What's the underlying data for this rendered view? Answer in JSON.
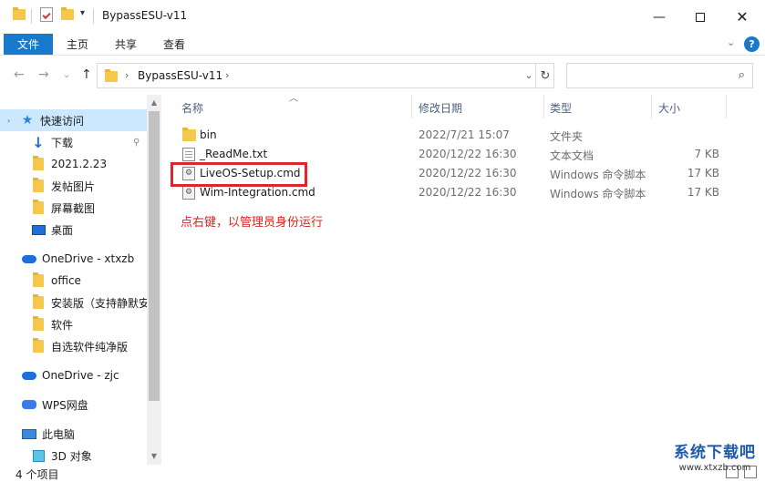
{
  "window": {
    "title": "BypassESU-v11",
    "minimize_icon": "minimize-icon",
    "maximize_icon": "maximize-icon",
    "close_icon": "close-icon"
  },
  "ribbon": {
    "tabs": [
      "文件",
      "主页",
      "共享",
      "查看"
    ],
    "accent": "#1979ca"
  },
  "address": {
    "path": "BypassESU-v11"
  },
  "search": {
    "placeholder": ""
  },
  "nav": {
    "items": [
      {
        "label": "快速访问",
        "icon": "star-icon"
      },
      {
        "label": "下载",
        "icon": "download-icon"
      },
      {
        "label": "2021.2.23",
        "icon": "folder-icon"
      },
      {
        "label": "发帖图片",
        "icon": "folder-icon"
      },
      {
        "label": "屏幕截图",
        "icon": "folder-icon"
      },
      {
        "label": "桌面",
        "icon": "desktop-icon"
      },
      {
        "label": "OneDrive - xtxzb",
        "icon": "cloud-icon"
      },
      {
        "label": "office",
        "icon": "folder-icon"
      },
      {
        "label": "安装版（支持静默安",
        "icon": "folder-icon"
      },
      {
        "label": "软件",
        "icon": "folder-icon"
      },
      {
        "label": "自选软件纯净版",
        "icon": "folder-icon"
      },
      {
        "label": "OneDrive - zjc",
        "icon": "cloud-icon"
      },
      {
        "label": "WPS网盘",
        "icon": "wps-cloud-icon"
      },
      {
        "label": "此电脑",
        "icon": "computer-icon"
      },
      {
        "label": "3D 对象",
        "icon": "3d-objects-icon"
      }
    ]
  },
  "columns": {
    "name": "名称",
    "modified": "修改日期",
    "type": "类型",
    "size": "大小"
  },
  "files": [
    {
      "name": "bin",
      "modified": "2022/7/21 15:07",
      "type": "文件夹",
      "size": "",
      "icon": "folder-icon"
    },
    {
      "name": "_ReadMe.txt",
      "modified": "2020/12/22 16:30",
      "type": "文本文档",
      "size": "7 KB",
      "icon": "text-file-icon"
    },
    {
      "name": "LiveOS-Setup.cmd",
      "modified": "2020/12/22 16:30",
      "type": "Windows 命令脚本",
      "size": "17 KB",
      "icon": "cmd-file-icon"
    },
    {
      "name": "Wim-Integration.cmd",
      "modified": "2020/12/22 16:30",
      "type": "Windows 命令脚本",
      "size": "17 KB",
      "icon": "cmd-file-icon"
    }
  ],
  "annotation": "点右键，以管理员身份运行",
  "annotation_color": "#d9261c",
  "status": {
    "item_count": "4 个项目"
  },
  "watermark": {
    "title": "系统下载吧",
    "url": "www.xtxzb.com"
  }
}
